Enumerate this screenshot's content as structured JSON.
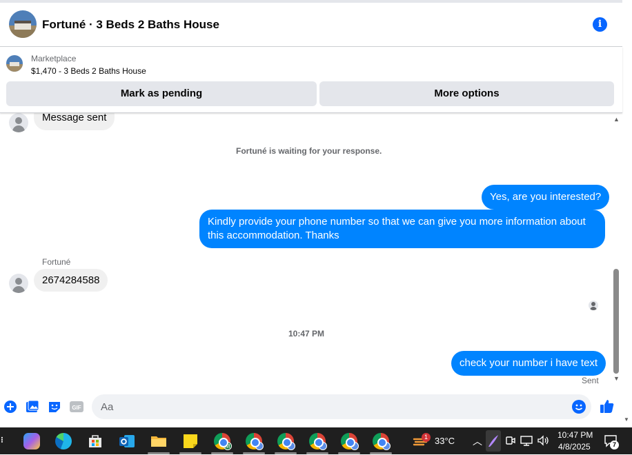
{
  "header": {
    "title": "Fortuné · 3 Beds 2 Baths House"
  },
  "marketplace": {
    "label": "Marketplace",
    "listing": "$1,470 - 3 Beds 2 Baths House",
    "mark_pending_label": "Mark as pending",
    "more_options_label": "More options"
  },
  "thread": {
    "top_partial_message": "Message sent",
    "waiting_notice": "Fortuné is waiting for your response.",
    "outgoing_1": "Yes, are you interested?",
    "outgoing_2": "Kindly provide your phone number so that we can give you more information about this accommodation. Thanks",
    "sender_name": "Fortuné",
    "incoming_1": "2674284588",
    "timestamp": "10:47 PM",
    "outgoing_3": "check your number i have text",
    "status": "Sent"
  },
  "composer": {
    "placeholder": "Aa",
    "gif_label": "GIF"
  },
  "taskbar": {
    "weather_temp": "33°C",
    "weather_badge": "1",
    "time": "10:47 PM",
    "date": "4/8/2025",
    "notification_count": "7",
    "chrome_first_badge": "M"
  },
  "colors": {
    "accent": "#0866ff",
    "outgoing_bubble": "#0084ff",
    "incoming_bubble": "#f0f0f0"
  }
}
